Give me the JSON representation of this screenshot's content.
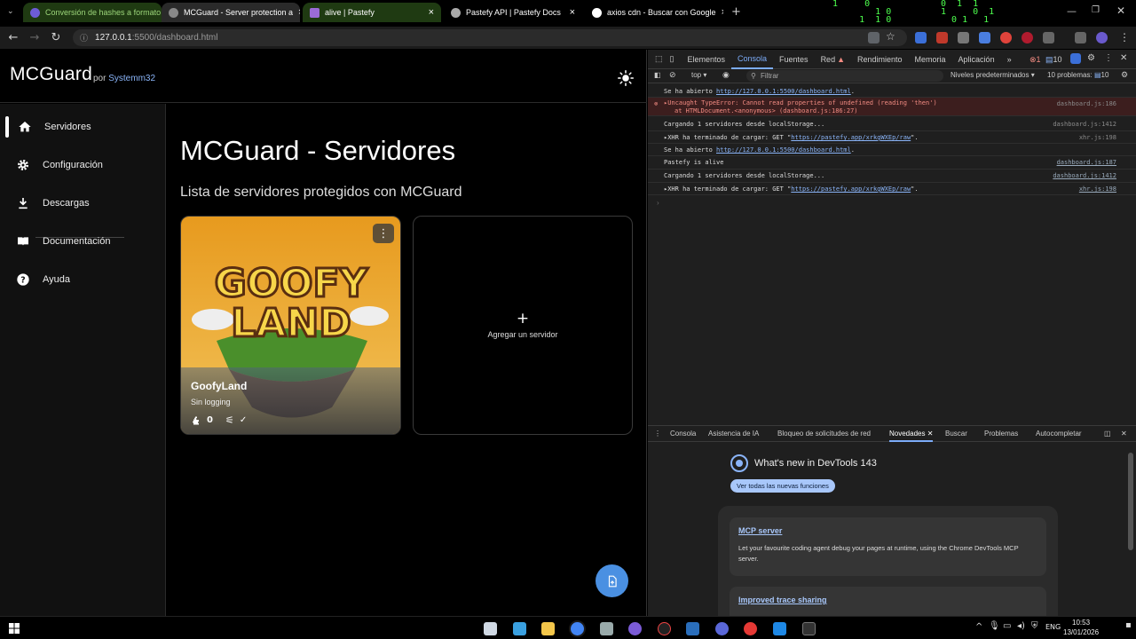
{
  "browser": {
    "tabs": [
      {
        "title": "Conversión de hashes a formato"
      },
      {
        "title": "MCGuard - Server protection a"
      },
      {
        "title": "alive | Pastefy"
      },
      {
        "title": "Pastefy API | Pastefy Docs"
      },
      {
        "title": "axios cdn - Buscar con Google"
      }
    ],
    "url_host": "127.0.0.1",
    "url_path": ":5500/dashboard.html"
  },
  "app": {
    "brand": "MCGuard",
    "by": "por",
    "author": "Systemm32",
    "nav": [
      {
        "label": "Servidores"
      },
      {
        "label": "Configuración"
      },
      {
        "label": "Descargas"
      },
      {
        "label": "Documentación"
      },
      {
        "label": "Ayuda"
      }
    ],
    "title": "MCGuard - Servidores",
    "subtitle": "Lista de servidores protegidos con MCGuard",
    "server": {
      "name": "GoofyLand",
      "logging": "Sin logging",
      "plugins": "0",
      "image_text_1": "GOOFY",
      "image_text_2": "LAND"
    },
    "add_server": "Agregar un servidor"
  },
  "devtools": {
    "tabs": [
      "Elementos",
      "Consola",
      "Fuentes",
      "Red",
      "Rendimiento",
      "Memoria",
      "Aplicación"
    ],
    "errors": "1",
    "messages": "10",
    "context": "top",
    "filter_placeholder": "Filtrar",
    "levels": "Niveles predeterminados",
    "problems": "10 problemas:",
    "problems_count": "10",
    "console": [
      {
        "text": "Se ha abierto ",
        "link": "http://127.0.0.1:5500/dashboard.html",
        "tail": ".",
        "src": ""
      },
      {
        "text": "Uncaught TypeError: Cannot read properties of undefined (reading 'then')",
        "text2": "at HTMLDocument.<anonymous> (dashboard.js:186:27)",
        "src": "dashboard.js:186"
      },
      {
        "text": "Cargando 1 servidores desde localStorage...",
        "src": "dashboard.js:1412"
      },
      {
        "text": "XHR ha terminado de cargar: GET \"",
        "link": "https://pastefy.app/xrkgWXEp/raw",
        "tail": "\".",
        "src": "xhr.js:198"
      },
      {
        "text": "Se ha abierto ",
        "link": "http://127.0.0.1:5500/dashboard.html",
        "tail": ".",
        "src": ""
      },
      {
        "text": "Pastefy is alive",
        "src": "dashboard.js:187"
      },
      {
        "text": "Cargando 1 servidores desde localStorage...",
        "src": "dashboard.js:1412"
      },
      {
        "text": "XHR ha terminado de cargar: GET \"",
        "link": "https://pastefy.app/xrkgWXEp/raw",
        "tail": "\".",
        "src": "xhr.js:198"
      }
    ],
    "drawer_tabs": [
      "Consola",
      "Asistencia de IA",
      "Bloqueo de solicitudes de red",
      "Novedades",
      "Buscar",
      "Problemas",
      "Autocompletar"
    ],
    "whats_new": "What's new in DevTools 143",
    "whats_new_button": "Ver todas las nuevas funciones",
    "features": [
      {
        "title": "MCP server",
        "desc": "Let your favourite coding agent debug your pages at runtime, using the Chrome DevTools MCP server."
      },
      {
        "title": "Improved trace sharing",
        "desc": ""
      }
    ]
  },
  "taskbar": {
    "lang": "ENG",
    "time": "10:53",
    "date": "13/01/2026"
  }
}
